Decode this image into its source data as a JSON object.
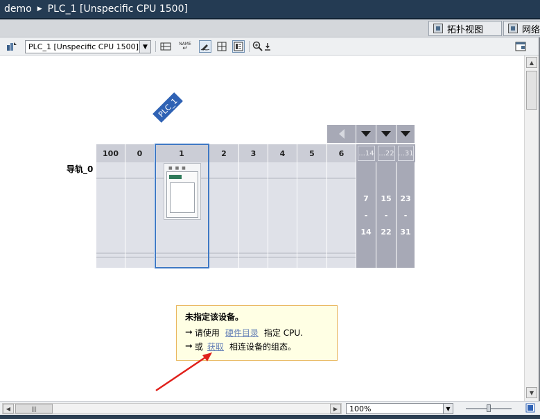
{
  "titlebar": {
    "project": "demo",
    "device": "PLC_1 [Unspecific CPU 1500]"
  },
  "view_tabs": [
    {
      "label": "拓扑视图",
      "icon": "topology-icon"
    },
    {
      "label": "网络",
      "icon": "network-icon"
    }
  ],
  "toolbar": {
    "device_select_value": "PLC_1 [Unspecific CPU 1500]",
    "name_badge": "NAME"
  },
  "device": {
    "name_tag": "PLC_1",
    "rail_label": "导轨_0",
    "slot_numbers": [
      "100",
      "0",
      "1",
      "2",
      "3",
      "4",
      "5",
      "6"
    ],
    "selected_slot": "1",
    "group_headers": [
      "...14",
      "...22",
      "...31"
    ],
    "group_ranges": [
      {
        "from": "7",
        "dash": "-",
        "to": "14"
      },
      {
        "from": "15",
        "dash": "-",
        "to": "22"
      },
      {
        "from": "23",
        "dash": "-",
        "to": "31"
      }
    ]
  },
  "info_box": {
    "title": "未指定该设备。",
    "line1_prefix": "请使用",
    "line1_link": "硬件目录",
    "line1_suffix": "指定 CPU.",
    "line2_prefix": "或",
    "line2_link": "获取",
    "line2_suffix": "相连设备的组态。"
  },
  "zoom": {
    "value": "100%",
    "level": 0.5
  },
  "colors": {
    "selection": "#3e78c4",
    "name_tag": "#2f62b4",
    "annotation_arrow": "#e0201b",
    "link": "#6a84b8"
  }
}
